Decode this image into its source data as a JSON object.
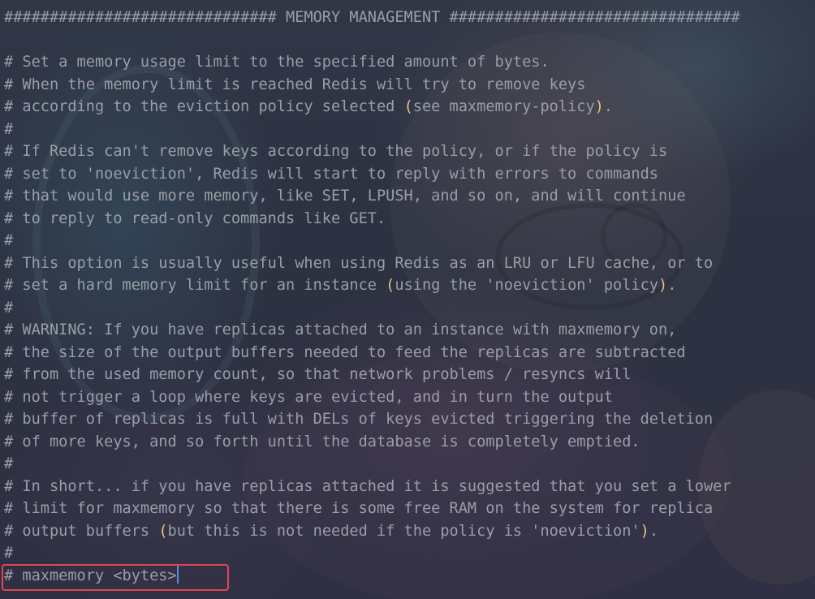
{
  "editor": {
    "section_header": "############################## MEMORY MANAGEMENT ################################",
    "lines": {
      "l1": "# Set a memory usage limit to the specified amount of bytes.",
      "l2": "# When the memory limit is reached Redis will try to remove keys",
      "l3a": "# according to the eviction policy selected ",
      "l3b": "see maxmemory-policy",
      "l3c": ".",
      "l4": "#",
      "l5": "# If Redis can't remove keys according to the policy, or if the policy is",
      "l6": "# set to 'noeviction', Redis will start to reply with errors to commands",
      "l7": "# that would use more memory, like SET, LPUSH, and so on, and will continue",
      "l8": "# to reply to read-only commands like GET.",
      "l9": "#",
      "l10": "# This option is usually useful when using Redis as an LRU or LFU cache, or to",
      "l11a": "# set a hard memory limit for an instance ",
      "l11b": "using the 'noeviction' policy",
      "l11c": ".",
      "l12": "#",
      "l13": "# WARNING: If you have replicas attached to an instance with maxmemory on,",
      "l14": "# the size of the output buffers needed to feed the replicas are subtracted",
      "l15": "# from the used memory count, so that network problems / resyncs will",
      "l16": "# not trigger a loop where keys are evicted, and in turn the output",
      "l17": "# buffer of replicas is full with DELs of keys evicted triggering the deletion",
      "l18": "# of more keys, and so forth until the database is completely emptied.",
      "l19": "#",
      "l20": "# In short... if you have replicas attached it is suggested that you set a lower",
      "l21": "# limit for maxmemory so that there is some free RAM on the system for replica",
      "l22a": "# output buffers ",
      "l22b": "but this is not needed if the policy is 'noeviction'",
      "l22c": ".",
      "l23": "#",
      "l24": "# maxmemory <bytes>"
    },
    "paren_open": "(",
    "paren_close": ")"
  },
  "colors": {
    "comment_text": "#9a9ea6",
    "paren": "#e5c07b",
    "highlight_border": "#e04652",
    "cursor": "#5f87d7"
  }
}
